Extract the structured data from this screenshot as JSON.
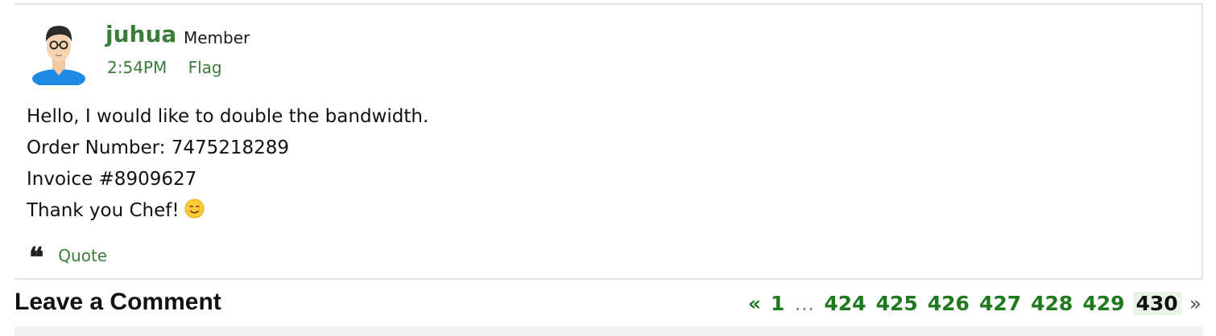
{
  "post": {
    "username": "juhua",
    "role": "Member",
    "time": "2:54PM",
    "flag_label": "Flag",
    "avatar_icon": "user-avatar-icon",
    "lines": [
      "Hello, I would like to double the bandwidth.",
      "Order Number: 7475218289",
      "Invoice #8909627",
      "Thank you Chef!"
    ],
    "emoji_icon": "smiling-face-icon",
    "quote_icon": "quote-icon",
    "quote_label": "Quote"
  },
  "comments": {
    "title": "Leave a Comment"
  },
  "pagination": {
    "prev": "«",
    "first": "1",
    "ellipsis": "…",
    "pages": [
      "424",
      "425",
      "426",
      "427",
      "428",
      "429"
    ],
    "current": "430",
    "next": "»"
  },
  "colors": {
    "accent_green": "#3a7d3a",
    "page_link_green": "#1f7a1f",
    "current_page_bg": "#eaf4e6",
    "border": "#e4e4e4"
  }
}
